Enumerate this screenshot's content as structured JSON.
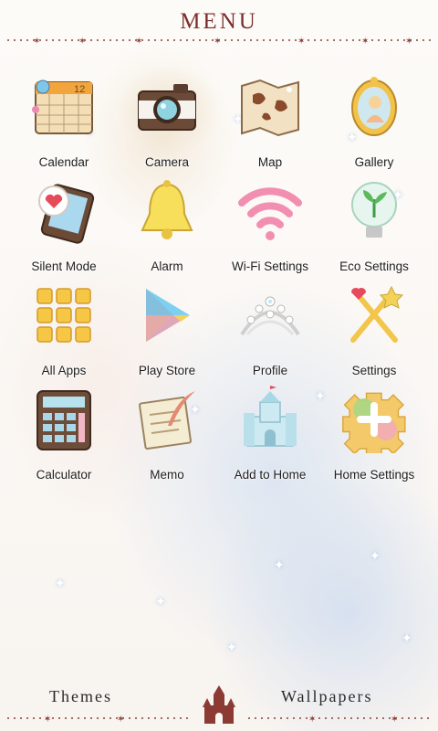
{
  "header": {
    "title": "MENU"
  },
  "apps": [
    {
      "label": "Calendar",
      "icon": "calendar-icon",
      "date_number": "12"
    },
    {
      "label": "Camera",
      "icon": "camera-icon"
    },
    {
      "label": "Map",
      "icon": "map-icon"
    },
    {
      "label": "Gallery",
      "icon": "gallery-icon"
    },
    {
      "label": "Silent Mode",
      "icon": "silent-mode-icon"
    },
    {
      "label": "Alarm",
      "icon": "bell-icon"
    },
    {
      "label": "Wi-Fi Settings",
      "icon": "wifi-icon"
    },
    {
      "label": "Eco Settings",
      "icon": "eco-bulb-icon"
    },
    {
      "label": "All Apps",
      "icon": "all-apps-grid-icon"
    },
    {
      "label": "Play Store",
      "icon": "play-store-icon"
    },
    {
      "label": "Profile",
      "icon": "tiara-icon"
    },
    {
      "label": "Settings",
      "icon": "magic-wand-icon"
    },
    {
      "label": "Calculator",
      "icon": "calculator-icon"
    },
    {
      "label": "Memo",
      "icon": "memo-quill-icon"
    },
    {
      "label": "Add to Home",
      "icon": "castle-icon"
    },
    {
      "label": "Home Settings",
      "icon": "puzzle-gear-icon"
    }
  ],
  "footer": {
    "themes_label": "Themes",
    "wallpapers_label": "Wallpapers",
    "center_icon": "castle-icon"
  },
  "colors": {
    "title": "#7d2d2a",
    "divider": "#8b3b34",
    "label": "#1e1e1e"
  }
}
